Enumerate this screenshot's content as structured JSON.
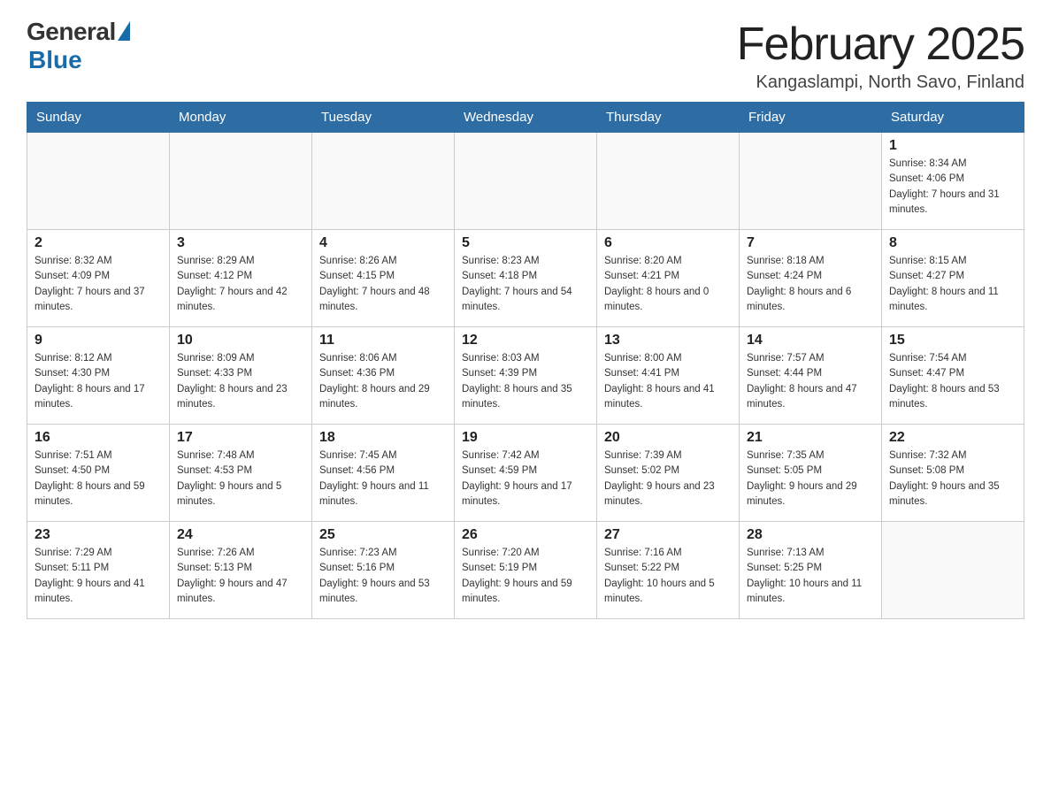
{
  "header": {
    "logo_general": "General",
    "logo_blue": "Blue",
    "month_title": "February 2025",
    "location": "Kangaslampi, North Savo, Finland"
  },
  "weekdays": [
    "Sunday",
    "Monday",
    "Tuesday",
    "Wednesday",
    "Thursday",
    "Friday",
    "Saturday"
  ],
  "weeks": [
    [
      {
        "day": "",
        "info": ""
      },
      {
        "day": "",
        "info": ""
      },
      {
        "day": "",
        "info": ""
      },
      {
        "day": "",
        "info": ""
      },
      {
        "day": "",
        "info": ""
      },
      {
        "day": "",
        "info": ""
      },
      {
        "day": "1",
        "info": "Sunrise: 8:34 AM\nSunset: 4:06 PM\nDaylight: 7 hours and 31 minutes."
      }
    ],
    [
      {
        "day": "2",
        "info": "Sunrise: 8:32 AM\nSunset: 4:09 PM\nDaylight: 7 hours and 37 minutes."
      },
      {
        "day": "3",
        "info": "Sunrise: 8:29 AM\nSunset: 4:12 PM\nDaylight: 7 hours and 42 minutes."
      },
      {
        "day": "4",
        "info": "Sunrise: 8:26 AM\nSunset: 4:15 PM\nDaylight: 7 hours and 48 minutes."
      },
      {
        "day": "5",
        "info": "Sunrise: 8:23 AM\nSunset: 4:18 PM\nDaylight: 7 hours and 54 minutes."
      },
      {
        "day": "6",
        "info": "Sunrise: 8:20 AM\nSunset: 4:21 PM\nDaylight: 8 hours and 0 minutes."
      },
      {
        "day": "7",
        "info": "Sunrise: 8:18 AM\nSunset: 4:24 PM\nDaylight: 8 hours and 6 minutes."
      },
      {
        "day": "8",
        "info": "Sunrise: 8:15 AM\nSunset: 4:27 PM\nDaylight: 8 hours and 11 minutes."
      }
    ],
    [
      {
        "day": "9",
        "info": "Sunrise: 8:12 AM\nSunset: 4:30 PM\nDaylight: 8 hours and 17 minutes."
      },
      {
        "day": "10",
        "info": "Sunrise: 8:09 AM\nSunset: 4:33 PM\nDaylight: 8 hours and 23 minutes."
      },
      {
        "day": "11",
        "info": "Sunrise: 8:06 AM\nSunset: 4:36 PM\nDaylight: 8 hours and 29 minutes."
      },
      {
        "day": "12",
        "info": "Sunrise: 8:03 AM\nSunset: 4:39 PM\nDaylight: 8 hours and 35 minutes."
      },
      {
        "day": "13",
        "info": "Sunrise: 8:00 AM\nSunset: 4:41 PM\nDaylight: 8 hours and 41 minutes."
      },
      {
        "day": "14",
        "info": "Sunrise: 7:57 AM\nSunset: 4:44 PM\nDaylight: 8 hours and 47 minutes."
      },
      {
        "day": "15",
        "info": "Sunrise: 7:54 AM\nSunset: 4:47 PM\nDaylight: 8 hours and 53 minutes."
      }
    ],
    [
      {
        "day": "16",
        "info": "Sunrise: 7:51 AM\nSunset: 4:50 PM\nDaylight: 8 hours and 59 minutes."
      },
      {
        "day": "17",
        "info": "Sunrise: 7:48 AM\nSunset: 4:53 PM\nDaylight: 9 hours and 5 minutes."
      },
      {
        "day": "18",
        "info": "Sunrise: 7:45 AM\nSunset: 4:56 PM\nDaylight: 9 hours and 11 minutes."
      },
      {
        "day": "19",
        "info": "Sunrise: 7:42 AM\nSunset: 4:59 PM\nDaylight: 9 hours and 17 minutes."
      },
      {
        "day": "20",
        "info": "Sunrise: 7:39 AM\nSunset: 5:02 PM\nDaylight: 9 hours and 23 minutes."
      },
      {
        "day": "21",
        "info": "Sunrise: 7:35 AM\nSunset: 5:05 PM\nDaylight: 9 hours and 29 minutes."
      },
      {
        "day": "22",
        "info": "Sunrise: 7:32 AM\nSunset: 5:08 PM\nDaylight: 9 hours and 35 minutes."
      }
    ],
    [
      {
        "day": "23",
        "info": "Sunrise: 7:29 AM\nSunset: 5:11 PM\nDaylight: 9 hours and 41 minutes."
      },
      {
        "day": "24",
        "info": "Sunrise: 7:26 AM\nSunset: 5:13 PM\nDaylight: 9 hours and 47 minutes."
      },
      {
        "day": "25",
        "info": "Sunrise: 7:23 AM\nSunset: 5:16 PM\nDaylight: 9 hours and 53 minutes."
      },
      {
        "day": "26",
        "info": "Sunrise: 7:20 AM\nSunset: 5:19 PM\nDaylight: 9 hours and 59 minutes."
      },
      {
        "day": "27",
        "info": "Sunrise: 7:16 AM\nSunset: 5:22 PM\nDaylight: 10 hours and 5 minutes."
      },
      {
        "day": "28",
        "info": "Sunrise: 7:13 AM\nSunset: 5:25 PM\nDaylight: 10 hours and 11 minutes."
      },
      {
        "day": "",
        "info": ""
      }
    ]
  ]
}
